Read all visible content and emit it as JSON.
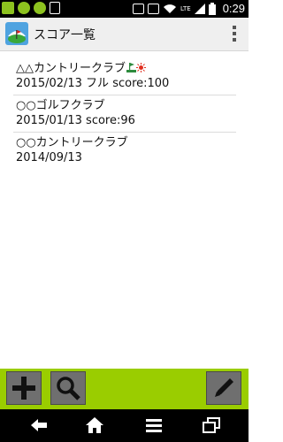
{
  "status_bar": {
    "network_label": "LTE",
    "battery_level": 1.0,
    "time": "0:29"
  },
  "action_bar": {
    "title": "スコア一覧",
    "icon": "app-icon",
    "overflow_icon": "overflow-menu-icon"
  },
  "rounds": [
    {
      "course": "△△カントリークラブ",
      "detail": "2015/02/13 フル score:100",
      "badges": [
        "flag-icon",
        "sun-icon"
      ]
    },
    {
      "course": "○○ゴルフクラブ",
      "detail": "2015/01/13  score:96",
      "badges": []
    },
    {
      "course": "○○カントリークラブ",
      "detail": "2014/09/13",
      "badges": []
    }
  ],
  "toolbar": {
    "buttons": [
      "add-icon",
      "search-icon",
      "edit-icon"
    ],
    "background": "#9acd00"
  },
  "nav_bar": {
    "buttons": [
      "back-icon",
      "home-icon",
      "menu-icon",
      "recent-apps-icon"
    ]
  }
}
